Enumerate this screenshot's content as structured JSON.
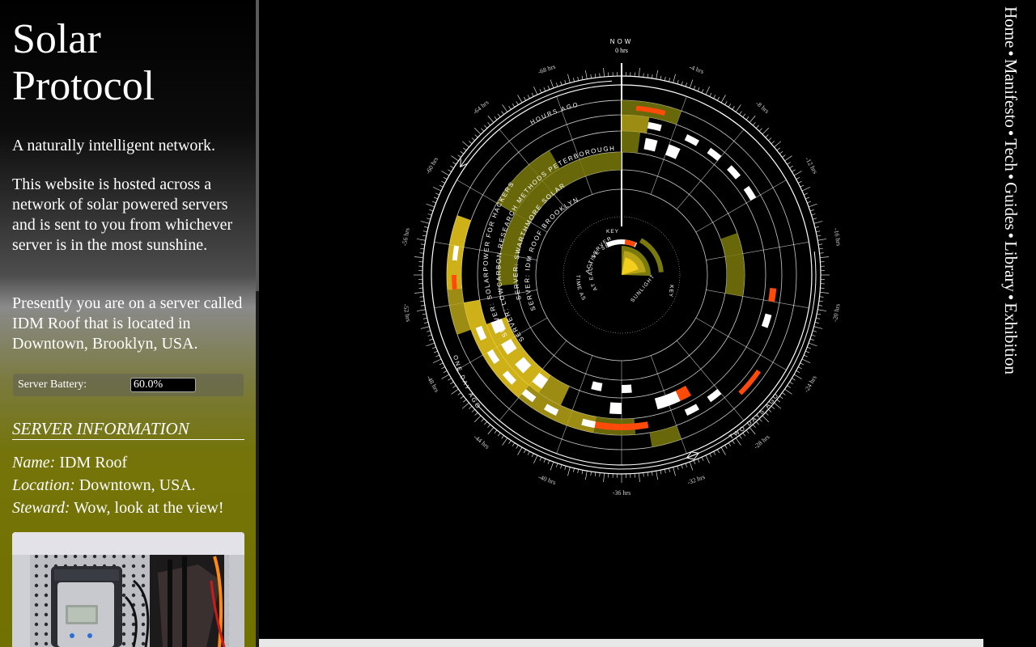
{
  "site": {
    "title_line1": "Solar",
    "title_line2": "Protocol",
    "tagline": "A naturally intelligent network.",
    "description": "This website is hosted across a network of solar powered servers and is sent to you from whichever server is in the most sunshine.",
    "location_text": "Presently you are on a server called IDM Roof that is located in Downtown, Brooklyn, USA."
  },
  "battery": {
    "label": "Server Battery:",
    "value": "60.0%"
  },
  "server_info": {
    "heading": "SERVER INFORMATION",
    "name_label": "Name:",
    "name_value": " IDM Roof",
    "location_label": "Location:",
    "location_value": " Downtown, USA.",
    "steward_label": "Steward:",
    "steward_value": " Wow, look at the view!"
  },
  "nav": {
    "items": [
      "Home",
      "Manifesto",
      "Tech",
      "Guides",
      "Library",
      "Exhibition"
    ],
    "separator": "•"
  },
  "chart": {
    "now_label": "NOW",
    "zero_label": "0 hrs",
    "hours_ago_label": "HOURS AGO",
    "one_day_ago_label": "ONE DAY AGO",
    "two_days_ago_label": "TWO DAYS AGO",
    "hour_ticks": [
      "-4 hrs",
      "-8 hrs",
      "-12 hrs",
      "-16 hrs",
      "-20 hrs",
      "-24 hrs",
      "-28 hrs",
      "-32 hrs",
      "-36 hrs",
      "-40 hrs",
      "-44 hrs",
      "-48 hrs",
      "-52 hrs",
      "-56 hrs",
      "-60 hrs",
      "-64 hrs",
      "-68 hrs"
    ],
    "server_labels": [
      "SERVER: SOLARPOWER FOR HACKERS",
      "SERVER: LOWCARBON RESEARCH METHODS PETERBOROUGH",
      "SERVER: SWARTHMORE SOLAR",
      "SERVER: IDM ROOF BROOKLYN"
    ],
    "key": {
      "title": "KEY",
      "active_label": "ACTIVE SERVER",
      "at_each_label": "AT EACH SERVER",
      "time_as_label": "TIME AS",
      "sunlight_label": "SUNLIGHT",
      "key_label": "KEY"
    },
    "colors": {
      "active": "#ffffff",
      "battery_low": "#ff4a0a",
      "sun_olive": "#7a7a0c",
      "sun_mid": "#b8a416",
      "sun_bright": "#f2cf1c"
    }
  },
  "chart_data": {
    "type": "radial-timeline",
    "range_hours": [
      -72,
      0
    ],
    "hour_tick_interval": 4,
    "rings": [
      {
        "server": "SOLARPOWER FOR HACKERS",
        "sunlight": [
          [
            0,
            -4,
            "olive"
          ],
          [
            -53,
            -58,
            "bright"
          ],
          [
            -50,
            -53,
            "mid"
          ],
          [
            -32,
            -34,
            "olive"
          ]
        ],
        "active": [
          [
            -55,
            -56
          ],
          [
            -53,
            -54
          ]
        ],
        "battery_low": [
          [
            -1,
            -3
          ],
          [
            -25,
            -27
          ],
          [
            -53,
            -54
          ]
        ]
      },
      {
        "server": "LOWCARBON RESEARCH METHODS PETERBOROUGH",
        "sunlight": [
          [
            0,
            -2,
            "mid"
          ],
          [
            -44,
            -52,
            "bright"
          ],
          [
            -38,
            -44,
            "mid"
          ],
          [
            -35,
            -38,
            "olive"
          ]
        ],
        "active": [
          [
            -2,
            -3
          ],
          [
            -5,
            -6
          ],
          [
            -7,
            -8
          ],
          [
            -9,
            -10
          ],
          [
            -11,
            -12
          ],
          [
            -21,
            -22
          ],
          [
            -28,
            -29
          ],
          [
            -30,
            -31
          ],
          [
            -38,
            -39
          ],
          [
            -41,
            -42
          ],
          [
            -43,
            -44
          ],
          [
            -45,
            -46
          ],
          [
            -47,
            -48
          ],
          [
            -49,
            -50
          ]
        ],
        "battery_low": [
          [
            -34,
            -38
          ],
          [
            -19,
            -20
          ]
        ]
      },
      {
        "server": "SWARTHMORE SOLAR",
        "sunlight": [
          [
            0,
            -1.5,
            "olive"
          ],
          [
            -43,
            -50,
            "bright"
          ],
          [
            -41,
            -43,
            "mid"
          ],
          [
            -60,
            -66,
            "olive"
          ]
        ],
        "active": [
          [
            -2,
            -3
          ],
          [
            -4,
            -5
          ],
          [
            -31,
            -33
          ],
          [
            -36,
            -37
          ],
          [
            -43,
            -44
          ],
          [
            -45,
            -46
          ],
          [
            -47,
            -48
          ],
          [
            -49,
            -50
          ]
        ],
        "battery_low": [
          [
            -30,
            -31
          ]
        ]
      },
      {
        "server": "IDM ROOF BROOKLYN",
        "sunlight": [
          [
            -14,
            -20,
            "olive"
          ],
          [
            -53,
            -72,
            "olive"
          ]
        ],
        "active": [
          [
            -35,
            -36
          ],
          [
            -38,
            -39
          ]
        ],
        "battery_low": []
      }
    ],
    "battery_percent": 60.0
  }
}
